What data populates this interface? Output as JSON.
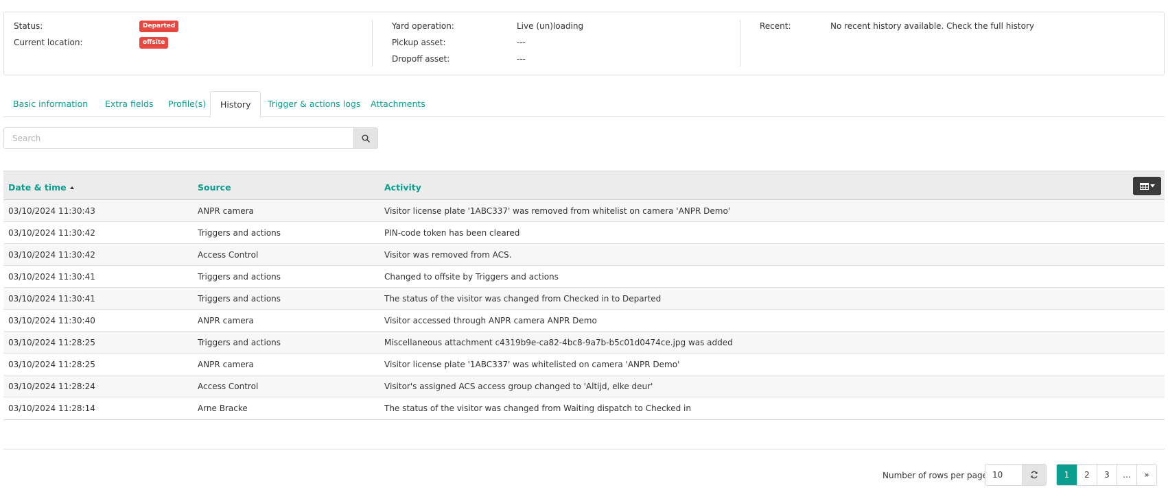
{
  "status_panel": {
    "status": {
      "label": "Status:",
      "value": "Departed"
    },
    "location": {
      "label": "Current location:",
      "value": "offsite"
    },
    "yard_operation": {
      "label": "Yard operation:",
      "value": "Live (un)loading"
    },
    "pickup_asset": {
      "label": "Pickup asset:",
      "value": "---"
    },
    "dropoff_asset": {
      "label": "Dropoff asset:",
      "value": "---"
    },
    "recent": {
      "label": "Recent:",
      "value": "No recent history available. Check the full history"
    },
    "badge_color": "#e8473f"
  },
  "tabs": [
    {
      "label": "Basic information"
    },
    {
      "label": "Extra fields"
    },
    {
      "label": "Profile(s)"
    },
    {
      "label": "History"
    },
    {
      "label": "Trigger & actions logs"
    },
    {
      "label": "Attachments"
    }
  ],
  "active_tab": "History",
  "search": {
    "placeholder": "Search",
    "value": "",
    "icon": "search-icon"
  },
  "table": {
    "columns": {
      "date": "Date & time",
      "source": "Source",
      "activity": "Activity"
    },
    "sort_column": "Date & time",
    "sort_direction": "ascending",
    "column_toggle_icon": "table-columns-icon",
    "rows": [
      {
        "date": "03/10/2024 11:30:43",
        "source": "ANPR camera",
        "activity": "Visitor license plate '1ABC337' was removed from whitelist on camera 'ANPR Demo'"
      },
      {
        "date": "03/10/2024 11:30:42",
        "source": "Triggers and actions",
        "activity": "PIN-code token has been cleared"
      },
      {
        "date": "03/10/2024 11:30:42",
        "source": "Access Control",
        "activity": "Visitor was removed from ACS."
      },
      {
        "date": "03/10/2024 11:30:41",
        "source": "Triggers and actions",
        "activity": "Changed to offsite by Triggers and actions"
      },
      {
        "date": "03/10/2024 11:30:41",
        "source": "Triggers and actions",
        "activity": "The status of the visitor was changed from Checked in to Departed"
      },
      {
        "date": "03/10/2024 11:30:40",
        "source": "ANPR camera",
        "activity": "Visitor accessed through ANPR camera ANPR Demo"
      },
      {
        "date": "03/10/2024 11:28:25",
        "source": "Triggers and actions",
        "activity": "Miscellaneous attachment c4319b9e-ca82-4bc8-9a7b-b5c01d0474ce.jpg was added"
      },
      {
        "date": "03/10/2024 11:28:25",
        "source": "ANPR camera",
        "activity": "Visitor license plate '1ABC337' was whitelisted on camera 'ANPR Demo'"
      },
      {
        "date": "03/10/2024 11:28:24",
        "source": "Access Control",
        "activity": "Visitor's assigned ACS access group changed to 'Altijd, elke deur'"
      },
      {
        "date": "03/10/2024 11:28:14",
        "source": "Arne Bracke",
        "activity": "The status of the visitor was changed from Waiting dispatch to Checked in"
      }
    ]
  },
  "footer": {
    "rows_label": "Number of rows per page",
    "rows_value": "10",
    "refresh_icon": "refresh-icon",
    "pages": [
      "1",
      "2",
      "3",
      "...",
      "»"
    ],
    "active_page": "1"
  },
  "colors": {
    "accent": "#0a9e8f",
    "header_bg": "#ececec",
    "dark_button": "#3a3a3a"
  }
}
